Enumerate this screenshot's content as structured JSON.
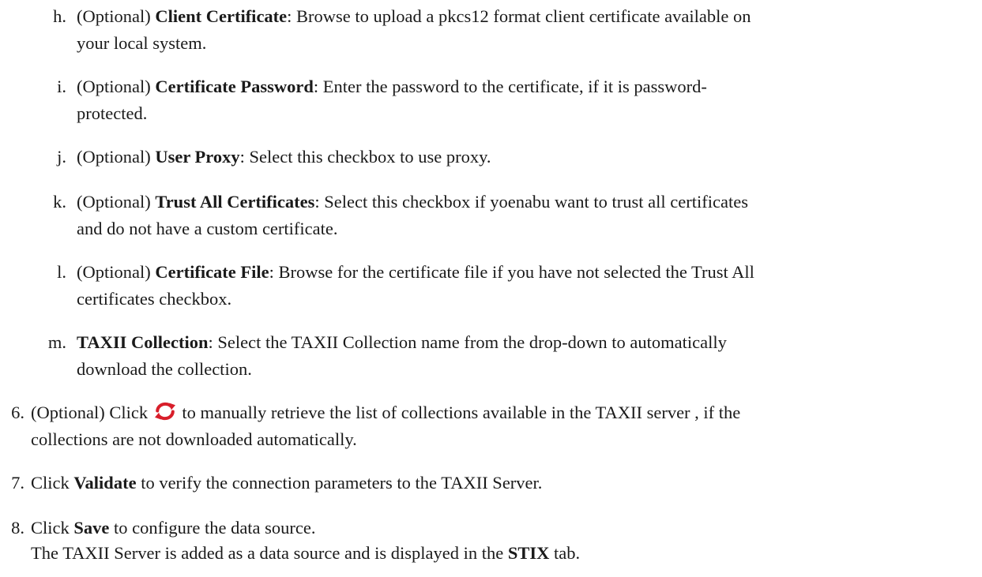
{
  "substeps": [
    {
      "marker": "h.",
      "prefix": "(Optional) ",
      "term": "Client Certificate",
      "line1": ": Browse to upload a pkcs12 format client certificate available on",
      "line2": "your local system."
    },
    {
      "marker": "i.",
      "prefix": "(Optional) ",
      "term": "Certificate Password",
      "line1": ": Enter the password to the certificate, if it is password-",
      "line2": "protected."
    },
    {
      "marker": "j.",
      "prefix": "(Optional) ",
      "term": "User Proxy",
      "line1": ": Select this checkbox to use proxy.",
      "line2": ""
    },
    {
      "marker": "k.",
      "prefix": "(Optional) ",
      "term": "Trust All Certificates",
      "line1": ": Select this checkbox if yoenabu want to trust all certificates",
      "line2": "and do not have a custom certificate."
    },
    {
      "marker": "l.",
      "prefix": "(Optional) ",
      "term": "Certificate File",
      "line1": ": Browse for the certificate file if you have not selected the Trust All",
      "line2": "certificates checkbox."
    },
    {
      "marker": "m.",
      "prefix": "",
      "term": "TAXII Collection",
      "line1": ": Select the TAXII Collection name from the drop-down to automatically",
      "line2": "download the collection."
    }
  ],
  "step6": {
    "marker": "6.",
    "before_icon": "(Optional) Click",
    "icon": "refresh-icon",
    "after_icon": " to manually retrieve the list of collections available in the TAXII server , if the",
    "line2": "collections are not downloaded automatically."
  },
  "step7": {
    "marker": "7.",
    "before": "Click ",
    "term": "Validate",
    "after": " to verify the connection parameters to the TAXII Server."
  },
  "step8": {
    "marker": "8.",
    "before": "Click ",
    "term": "Save",
    "after": " to configure the data source.",
    "line2_before": "The TAXII Server is added as a data source and is displayed in the ",
    "line2_term": "STIX",
    "line2_after": " tab."
  },
  "colors": {
    "text": "#1a1a1a",
    "refresh_icon": "#d81e2a"
  }
}
